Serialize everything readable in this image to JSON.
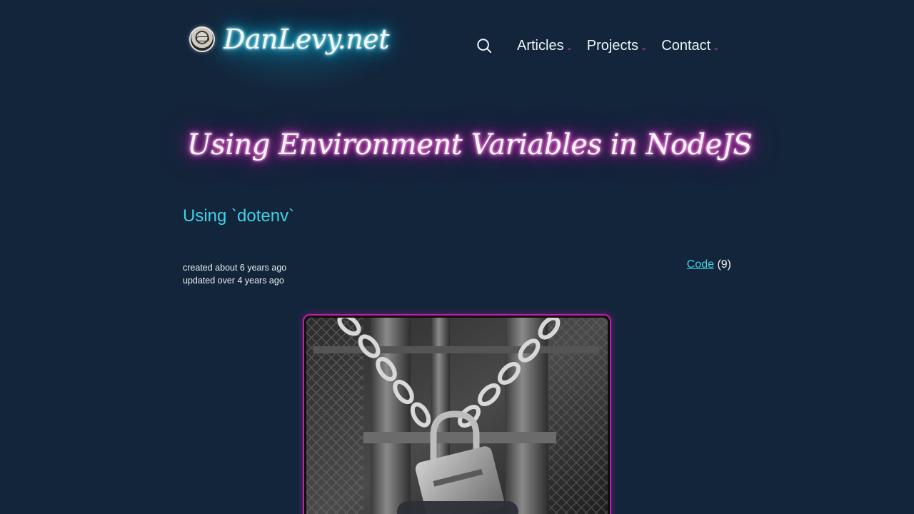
{
  "site": {
    "brand_name": "DanLevy.net",
    "accent_cyan": "#3fd3e6",
    "accent_magenta": "#e040c8",
    "background": "#13253a"
  },
  "nav": {
    "search_icon": "search-icon",
    "items": [
      {
        "label": "Articles",
        "chevron": "⌄"
      },
      {
        "label": "Projects",
        "chevron": "⌄"
      },
      {
        "label": "Contact",
        "chevron": "⌄"
      }
    ]
  },
  "article": {
    "title": "Using Environment Variables in NodeJS",
    "subtitle": "Using `dotenv`",
    "created": "created about 6 years ago",
    "updated": "updated over 4 years ago",
    "tag_label": "Code",
    "tag_count": "(9)",
    "hero_image": "padlock-chain-gate-photo"
  }
}
